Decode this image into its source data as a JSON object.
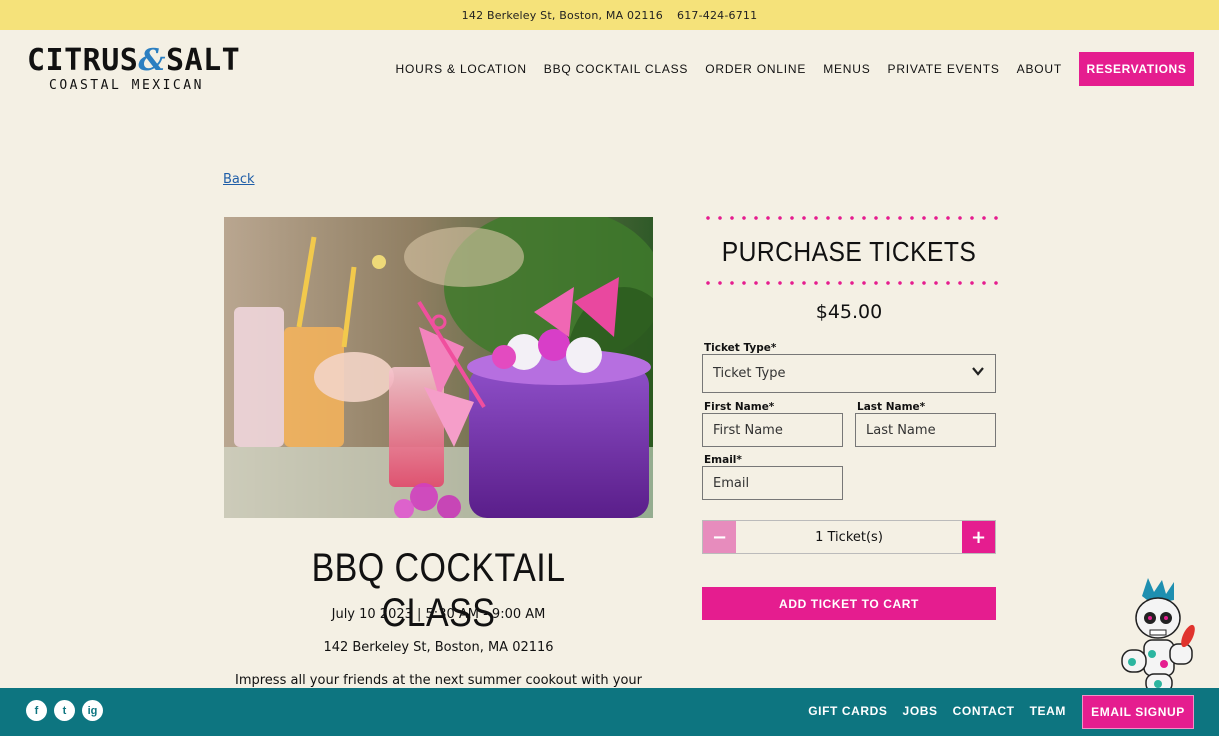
{
  "topbar": {
    "address": "142 Berkeley St, Boston, MA 02116",
    "phone": "617-424-6711"
  },
  "logo": {
    "part1": "CITRUS",
    "amp": "&",
    "part2": "SALT",
    "tagline": "COASTAL MEXICAN"
  },
  "nav": {
    "items": [
      "HOURS & LOCATION",
      "BBQ COCKTAIL CLASS",
      "ORDER ONLINE",
      "MENUS",
      "PRIVATE EVENTS",
      "ABOUT"
    ],
    "reservations": "RESERVATIONS"
  },
  "back": "Back",
  "event": {
    "title": "BBQ COCKTAIL CLASS",
    "date": "July 10 2023 | 5:30 AM - 9:00 AM",
    "address": "142 Berkeley St, Boston, MA 02116",
    "description": "Impress all your friends at the next summer cookout  with your"
  },
  "purchase": {
    "title": "PURCHASE TICKETS",
    "price": "$45.00",
    "ticket_type_label": "Ticket Type*",
    "ticket_type_value": "Ticket Type",
    "first_name_label": "First Name*",
    "first_name_placeholder": "First Name",
    "last_name_label": "Last Name*",
    "last_name_placeholder": "Last Name",
    "email_label": "Email*",
    "email_placeholder": "Email",
    "quantity": "1 Ticket(s)",
    "minus": "−",
    "plus": "+",
    "add_to_cart": "ADD TICKET TO CART"
  },
  "footer": {
    "social": [
      "f",
      "t",
      "ig"
    ],
    "links": [
      "GIFT CARDS",
      "JOBS",
      "CONTACT",
      "TEAM"
    ],
    "email_signup": "EMAIL SIGNUP"
  },
  "colors": {
    "accent": "#e51d8f",
    "footer": "#0d7580",
    "topbar": "#f5e27a",
    "background": "#f4f0e4"
  }
}
